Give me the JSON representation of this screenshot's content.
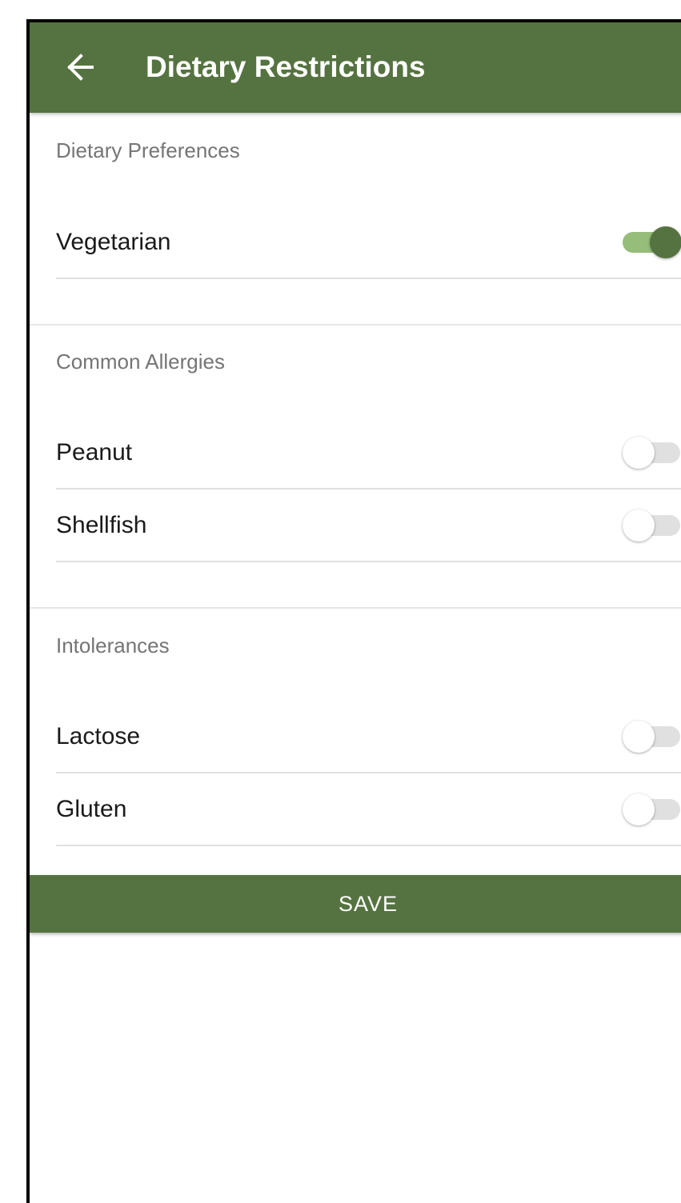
{
  "appbar": {
    "title": "Dietary Restrictions",
    "back_icon": "arrow-left-icon",
    "color": "#557340"
  },
  "sections": [
    {
      "header": "Dietary Preferences",
      "items": [
        {
          "label": "Vegetarian",
          "enabled": true
        }
      ]
    },
    {
      "header": "Common Allergies",
      "items": [
        {
          "label": "Peanut",
          "enabled": false
        },
        {
          "label": "Shellfish",
          "enabled": false
        }
      ]
    },
    {
      "header": "Intolerances",
      "items": [
        {
          "label": "Lactose",
          "enabled": false
        },
        {
          "label": "Gluten",
          "enabled": false
        }
      ]
    }
  ],
  "save_button": {
    "label": "SAVE"
  },
  "colors": {
    "primary": "#557340",
    "switch_track_on": "#96bd7a",
    "switch_track_off": "#e0e0e0",
    "section_header_text": "#757575"
  }
}
